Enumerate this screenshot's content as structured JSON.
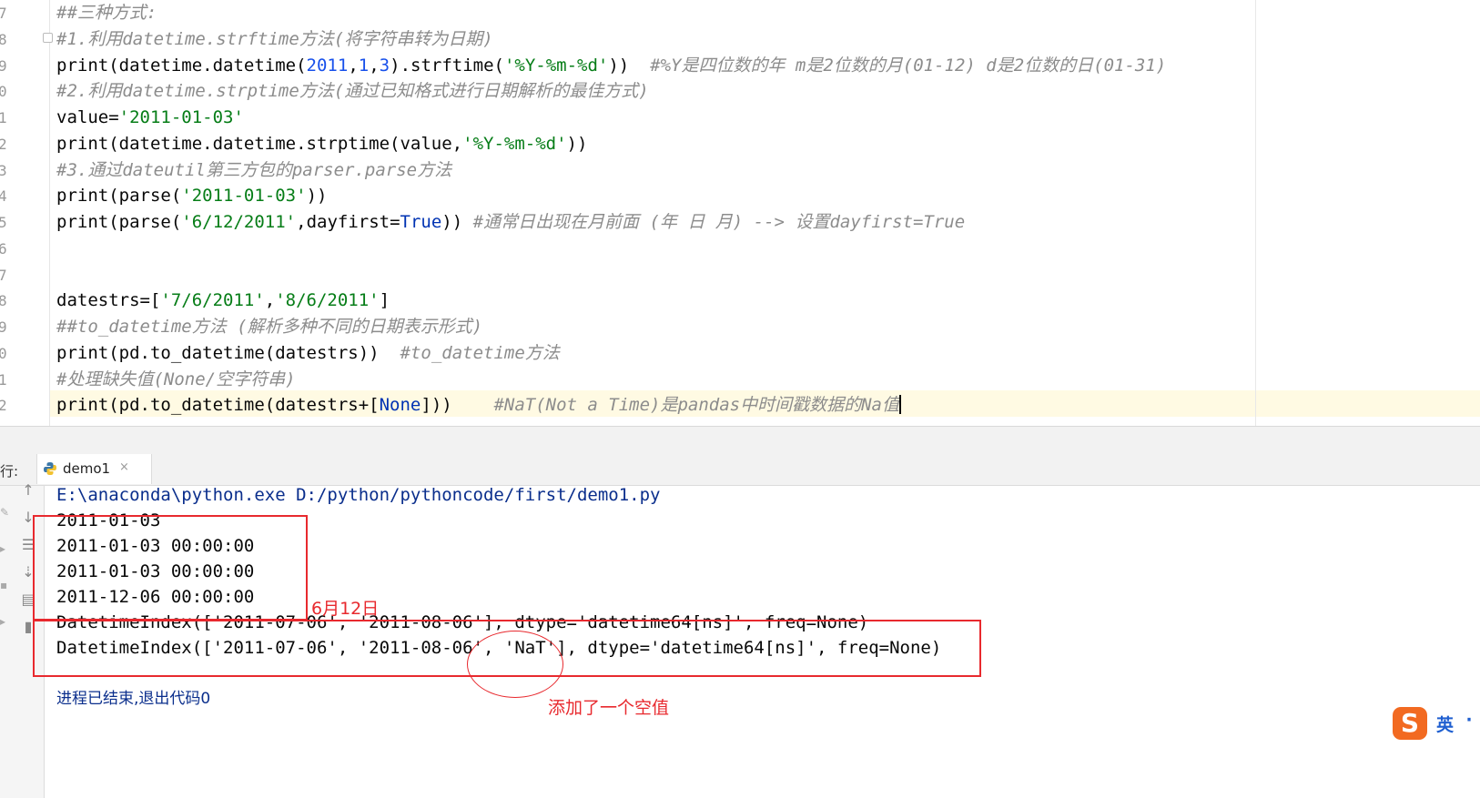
{
  "editor": {
    "gutter_numbers": [
      "7",
      "8",
      "9",
      "0",
      "1",
      "2",
      "3",
      "4",
      "5",
      "6",
      "7",
      "8",
      "9",
      "0",
      "1",
      "2"
    ],
    "lines": [
      [
        {
          "t": "##三种方式:",
          "c": "cm"
        }
      ],
      [
        {
          "t": "#1.利用datetime.strftime方法(将字符串转为日期)",
          "c": "cm"
        }
      ],
      [
        {
          "t": "print(datetime.datetime(",
          "c": ""
        },
        {
          "t": "2011",
          "c": "num"
        },
        {
          "t": ",",
          "c": ""
        },
        {
          "t": "1",
          "c": "num"
        },
        {
          "t": ",",
          "c": ""
        },
        {
          "t": "3",
          "c": "num"
        },
        {
          "t": ").strftime(",
          "c": ""
        },
        {
          "t": "'%Y-%m-%d'",
          "c": "str"
        },
        {
          "t": "))  ",
          "c": ""
        },
        {
          "t": "#%Y是四位数的年 m是2位数的月(01-12) d是2位数的日(01-31)",
          "c": "cm"
        }
      ],
      [
        {
          "t": "#2.利用datetime.strptime方法(通过已知格式进行日期解析的最佳方式)",
          "c": "cm"
        }
      ],
      [
        {
          "t": "value=",
          "c": ""
        },
        {
          "t": "'2011-01-03'",
          "c": "str"
        }
      ],
      [
        {
          "t": "print(datetime.datetime.strptime(value,",
          "c": ""
        },
        {
          "t": "'%Y-%m-%d'",
          "c": "str"
        },
        {
          "t": "))",
          "c": ""
        }
      ],
      [
        {
          "t": "#3.通过dateutil第三方包的parser.parse方法",
          "c": "cm"
        }
      ],
      [
        {
          "t": "print(parse(",
          "c": ""
        },
        {
          "t": "'2011-01-03'",
          "c": "str"
        },
        {
          "t": "))",
          "c": ""
        }
      ],
      [
        {
          "t": "print(parse(",
          "c": ""
        },
        {
          "t": "'6/12/2011'",
          "c": "str"
        },
        {
          "t": ",dayfirst=",
          "c": ""
        },
        {
          "t": "True",
          "c": "kw"
        },
        {
          "t": ")) ",
          "c": ""
        },
        {
          "t": "#通常日出现在月前面 (年 日 月) --> 设置dayfirst=True",
          "c": "cm"
        }
      ],
      [],
      [],
      [
        {
          "t": "datestrs=[",
          "c": ""
        },
        {
          "t": "'7/6/2011'",
          "c": "str"
        },
        {
          "t": ",",
          "c": ""
        },
        {
          "t": "'8/6/2011'",
          "c": "str"
        },
        {
          "t": "]",
          "c": ""
        }
      ],
      [
        {
          "t": "##to_datetime方法 (解析多种不同的日期表示形式)",
          "c": "cm"
        }
      ],
      [
        {
          "t": "print(pd.to_datetime(datestrs))  ",
          "c": ""
        },
        {
          "t": "#to_datetime方法",
          "c": "cm"
        }
      ],
      [
        {
          "t": "#处理缺失值(None/空字符串)",
          "c": "cm"
        }
      ],
      [
        {
          "t": "print(pd.to_datetime(datestrs+[",
          "c": ""
        },
        {
          "t": "None",
          "c": "kw"
        },
        {
          "t": "]))    ",
          "c": ""
        },
        {
          "t": "#NaT(Not a Time)是pandas中时间戳数据的Na值",
          "c": "cm"
        }
      ]
    ]
  },
  "run_panel": {
    "label": "行:",
    "tab_label": "demo1",
    "tab_close": "×",
    "command": "E:\\anaconda\\python.exe D:/python/pythoncode/first/demo1.py",
    "output": [
      "2011-01-03",
      "2011-01-03 00:00:00",
      "2011-01-03 00:00:00",
      "2011-12-06 00:00:00",
      "DatetimeIndex(['2011-07-06', '2011-08-06'], dtype='datetime64[ns]', freq=None)",
      "DatetimeIndex(['2011-07-06', '2011-08-06', 'NaT'], dtype='datetime64[ns]', freq=None)"
    ],
    "exit_message": "进程已结束,退出代码0"
  },
  "annotations": {
    "note_date": "6月12日",
    "note_null": "添加了一个空值",
    "color": "#e8292e"
  },
  "ime": {
    "logo": "S",
    "mode": "英",
    "dot": "·"
  },
  "colors": {
    "comment": "#8c8c8c",
    "string": "#067d17",
    "number": "#1750eb",
    "keyword": "#0033b3",
    "current_line": "#fffae3"
  }
}
